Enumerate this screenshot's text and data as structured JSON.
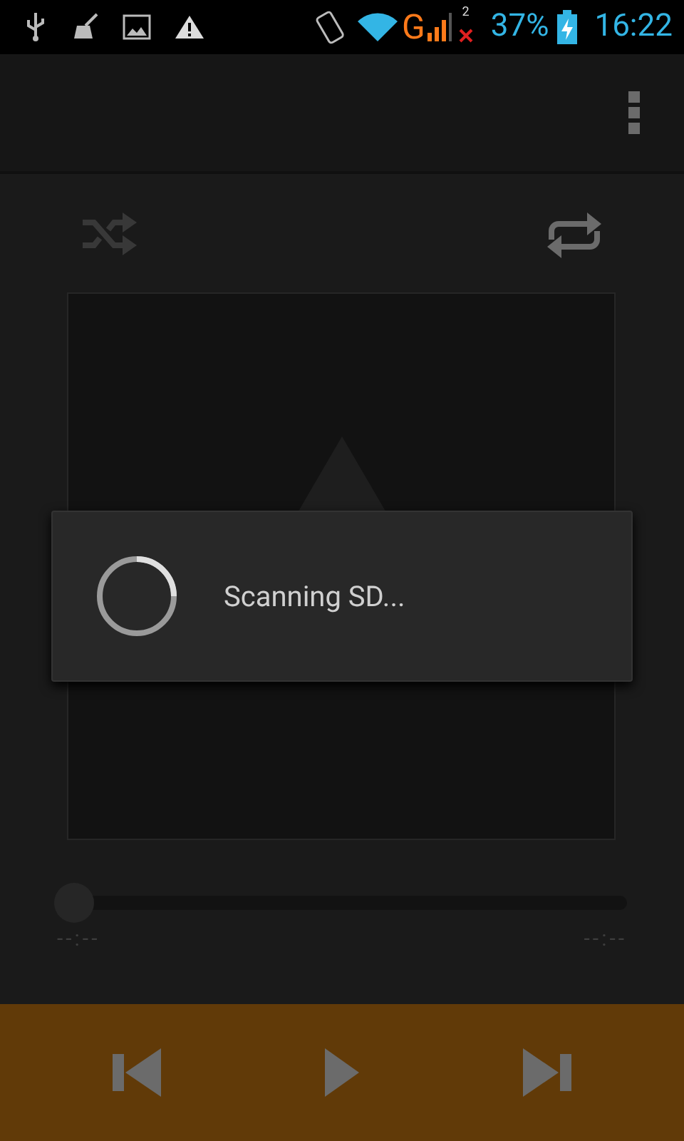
{
  "status_bar": {
    "network": "G",
    "sim_slot": "2",
    "battery": "37%",
    "time": "16:22"
  },
  "player": {
    "seek": {
      "level": 0
    },
    "elapsed": "--:--",
    "duration": "--:--"
  },
  "dialog": {
    "message": "Scanning SD..."
  }
}
